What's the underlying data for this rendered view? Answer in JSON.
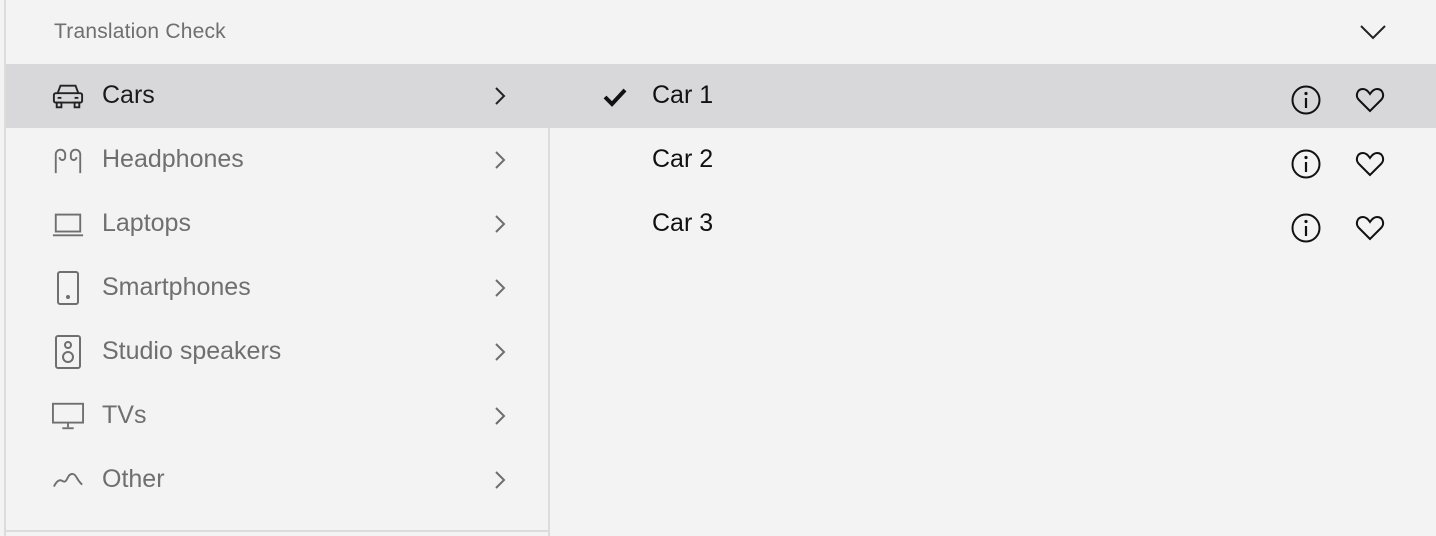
{
  "header": {
    "title": "Translation Check",
    "collapse_icon": "chevron-down-icon"
  },
  "categories": [
    {
      "label": "Cars",
      "icon": "car-icon",
      "selected": true
    },
    {
      "label": "Headphones",
      "icon": "headphones-icon",
      "selected": false
    },
    {
      "label": "Laptops",
      "icon": "laptop-icon",
      "selected": false
    },
    {
      "label": "Smartphones",
      "icon": "smartphone-icon",
      "selected": false
    },
    {
      "label": "Studio speakers",
      "icon": "speaker-icon",
      "selected": false
    },
    {
      "label": "TVs",
      "icon": "tv-icon",
      "selected": false
    },
    {
      "label": "Other",
      "icon": "wave-icon",
      "selected": false
    }
  ],
  "items": [
    {
      "label": "Car 1",
      "checked": true
    },
    {
      "label": "Car 2",
      "checked": false
    },
    {
      "label": "Car 3",
      "checked": false
    }
  ],
  "colors": {
    "background": "#f3f3f3",
    "selected_row": "#d8d8da",
    "muted_text": "#6f6f6f",
    "primary_text": "#111111",
    "divider": "#dcdcdc"
  }
}
